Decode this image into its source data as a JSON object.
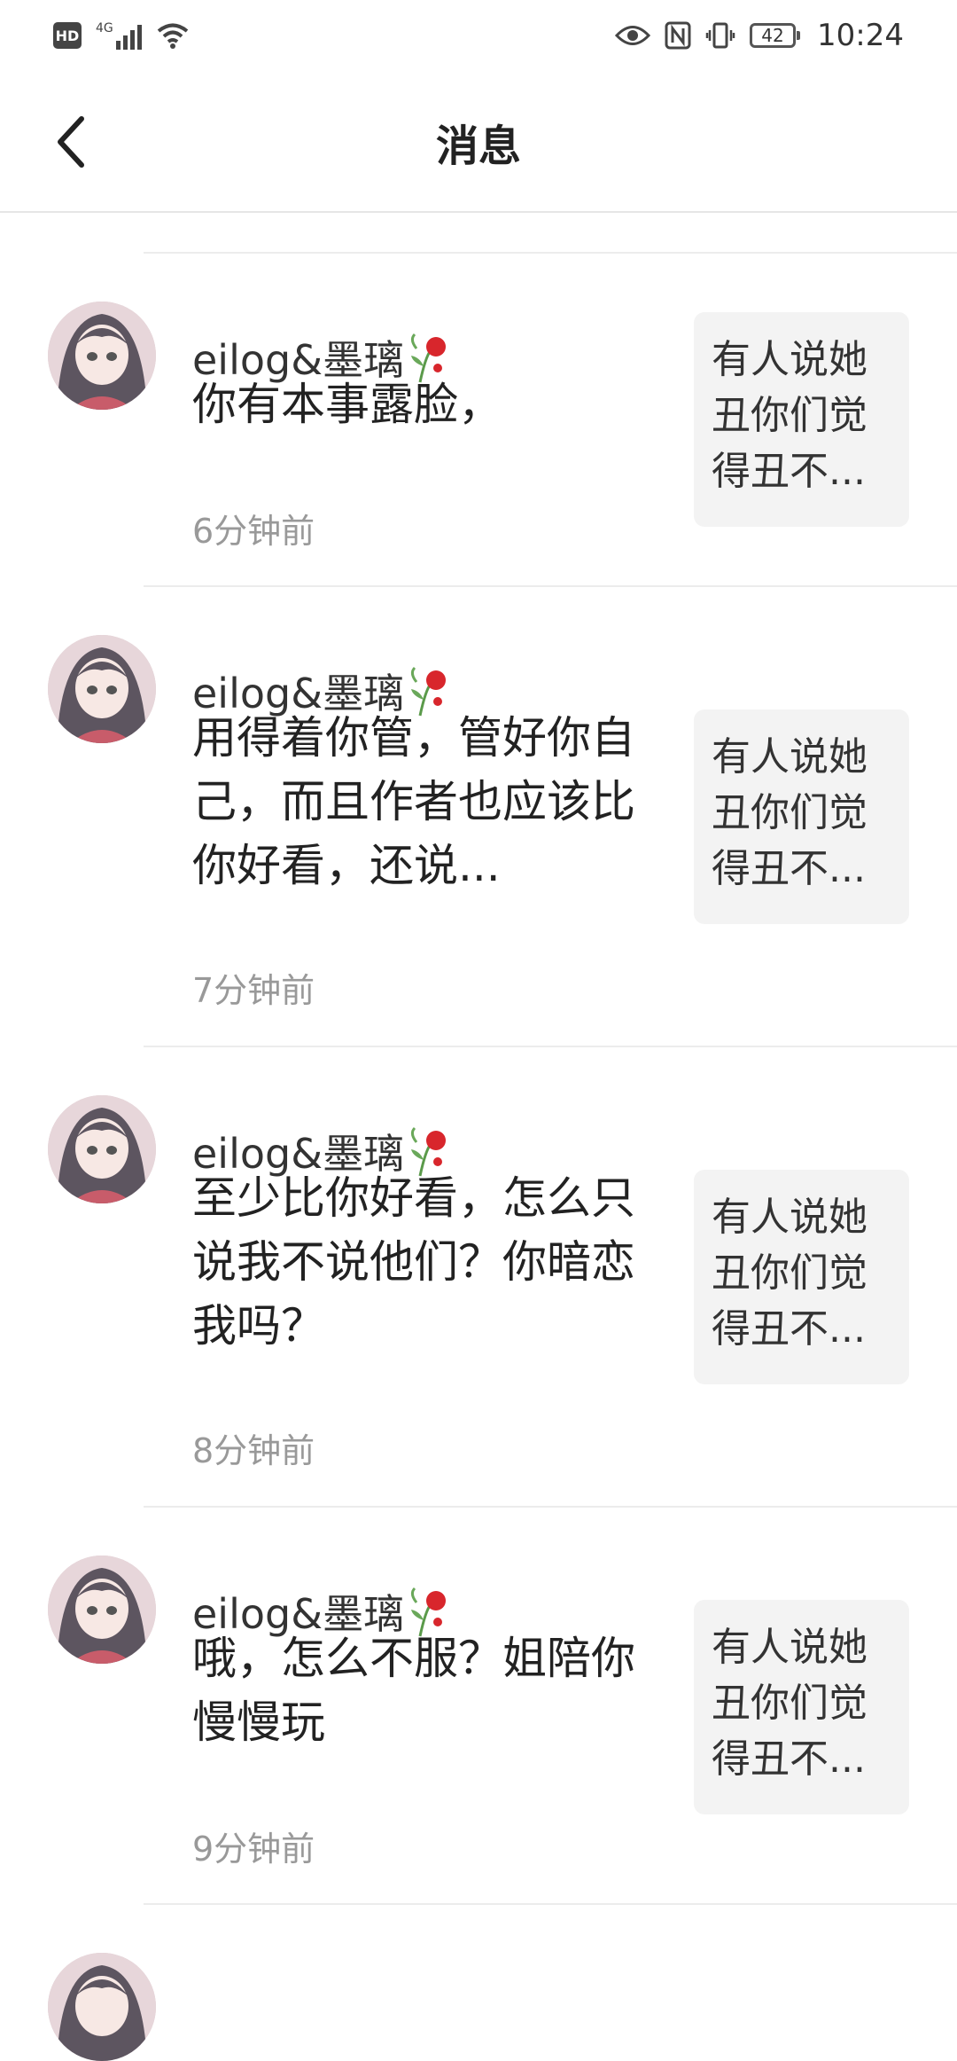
{
  "status_bar": {
    "network": "4G",
    "battery": "42",
    "time": "10:24"
  },
  "header": {
    "title": "消息"
  },
  "notifications": [
    {
      "username": "eilog&墨璃",
      "message": "你有本事露脸，",
      "time": "6分钟前",
      "preview": "有人说她丑你们觉得丑不..."
    },
    {
      "username": "eilog&墨璃",
      "message": "用得着你管，管好你自己，而且作者也应该比你好看，还说...",
      "time": "7分钟前",
      "preview": "有人说她丑你们觉得丑不..."
    },
    {
      "username": "eilog&墨璃",
      "message": "至少比你好看，怎么只说我不说他们？你暗恋我吗？",
      "time": "8分钟前",
      "preview": "有人说她丑你们觉得丑不..."
    },
    {
      "username": "eilog&墨璃",
      "message": "哦，怎么不服？姐陪你慢慢玩",
      "time": "9分钟前",
      "preview": "有人说她丑你们觉得丑不..."
    }
  ]
}
